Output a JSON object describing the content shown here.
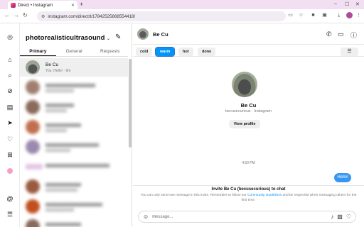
{
  "browser": {
    "tab_title": "Direct • Instagram",
    "url": "instagram.com/direct/t/17842525868554418/"
  },
  "inbox": {
    "account": "photorealisticultrasound",
    "tabs": [
      "Primary",
      "General",
      "Requests"
    ],
    "conversations": [
      {
        "name": "Be Cu",
        "sub": "You: Hello! · 9m",
        "active": true
      }
    ]
  },
  "thread": {
    "name": "Be Cu",
    "chips": [
      "cold",
      "warm",
      "hot",
      "done"
    ],
    "selected_chip": "warm",
    "profile_name": "Be Cu",
    "profile_sub": "becusecurious · Instagram",
    "view_profile": "View profile",
    "timestamp": "4:50 PM",
    "message": "Hello!",
    "invite_title": "Invite Be Cu (becusecurious) to chat",
    "invite_body_1": "You can only send one message in this invite. Remember to follow our ",
    "invite_link": "Community Guidelines",
    "invite_body_2": " and be respectful when messaging others for the first time.",
    "input_placeholder": "Message..."
  },
  "colors": {
    "accent": "#0095f6",
    "bubble": "#3797f0",
    "tabbar": "#f3dff2"
  }
}
